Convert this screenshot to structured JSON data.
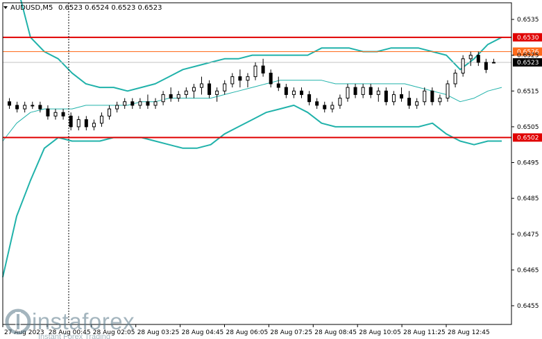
{
  "header": {
    "symbol": "AUDUSD,M5",
    "ohlc": "0.6523 0.6524 0.6523 0.6523"
  },
  "watermark": {
    "logo_icon": "instaforex-logo-icon",
    "name": "instaforex",
    "tagline": "Instant Forex Trading"
  },
  "chart_data": {
    "type": "candlestick",
    "instrument": "AUDUSD",
    "timeframe": "M5",
    "ylim": [
      0.6451,
      0.654
    ],
    "y_ticks": [
      "0.6535",
      "0.6525",
      "0.6515",
      "0.6505",
      "0.6495",
      "0.6485",
      "0.6475",
      "0.6465",
      "0.6455"
    ],
    "y_tick_values": [
      0.6535,
      0.6525,
      0.6515,
      0.6505,
      0.6495,
      0.6485,
      0.6475,
      0.6465,
      0.6455
    ],
    "x_ticks": [
      "27 Aug 2023",
      "28 Aug 00:45",
      "28 Aug 02:05",
      "28 Aug 03:25",
      "28 Aug 04:45",
      "28 Aug 06:05",
      "28 Aug 07:25",
      "28 Aug 08:45",
      "28 Aug 10:05",
      "28 Aug 11:25",
      "28 Aug 12:45"
    ],
    "levels": [
      {
        "name": "resistance",
        "value": 0.653,
        "label": "0.6530",
        "color": "#e00000"
      },
      {
        "name": "target",
        "value": 0.6526,
        "label": "0.6526",
        "color": "#ff6a1a"
      },
      {
        "name": "support",
        "value": 0.6502,
        "label": "0.6502",
        "color": "#e00000"
      }
    ],
    "current_price": {
      "value": 0.6523,
      "label": "0.6523",
      "color": "#000000"
    },
    "bollinger": {
      "color": "#20b2aa",
      "upper": [
        0.6562,
        0.6545,
        0.653,
        0.6526,
        0.6524,
        0.652,
        0.6517,
        0.6516,
        0.6516,
        0.6515,
        0.6516,
        0.6517,
        0.6519,
        0.6521,
        0.6522,
        0.6523,
        0.6524,
        0.6524,
        0.6525,
        0.6525,
        0.6525,
        0.6525,
        0.6525,
        0.6527,
        0.6527,
        0.6527,
        0.6526,
        0.6526,
        0.6527,
        0.6527,
        0.6527,
        0.6526,
        0.6525,
        0.6521,
        0.6524,
        0.6528,
        0.653
      ],
      "middle": [
        0.6501,
        0.6506,
        0.6509,
        0.651,
        0.651,
        0.651,
        0.6511,
        0.6511,
        0.6511,
        0.6511,
        0.6512,
        0.6512,
        0.6513,
        0.6513,
        0.6513,
        0.6513,
        0.6514,
        0.6515,
        0.6516,
        0.6517,
        0.6518,
        0.6518,
        0.6518,
        0.6518,
        0.6517,
        0.6517,
        0.6517,
        0.6517,
        0.6517,
        0.6517,
        0.6516,
        0.6515,
        0.6514,
        0.6512,
        0.6513,
        0.6515,
        0.6516
      ],
      "lower": [
        0.6463,
        0.648,
        0.649,
        0.6499,
        0.6502,
        0.6501,
        0.6501,
        0.6501,
        0.6502,
        0.6502,
        0.6502,
        0.6501,
        0.65,
        0.6499,
        0.6499,
        0.65,
        0.6503,
        0.6505,
        0.6507,
        0.6509,
        0.651,
        0.6511,
        0.6509,
        0.6506,
        0.6505,
        0.6505,
        0.6505,
        0.6505,
        0.6505,
        0.6505,
        0.6505,
        0.6506,
        0.6503,
        0.6501,
        0.65,
        0.6501,
        0.6501
      ]
    },
    "candles": [
      [
        0.6512,
        0.6513,
        0.651,
        0.6511
      ],
      [
        0.6511,
        0.6512,
        0.6509,
        0.651
      ],
      [
        0.651,
        0.6512,
        0.6509,
        0.6511
      ],
      [
        0.6511,
        0.6512,
        0.651,
        0.6511
      ],
      [
        0.6511,
        0.6512,
        0.6509,
        0.651
      ],
      [
        0.651,
        0.6511,
        0.6507,
        0.6508
      ],
      [
        0.6508,
        0.651,
        0.6507,
        0.6509
      ],
      [
        0.6509,
        0.651,
        0.6507,
        0.6508
      ],
      [
        0.6508,
        0.6509,
        0.6504,
        0.6505
      ],
      [
        0.6505,
        0.6508,
        0.6504,
        0.6507
      ],
      [
        0.6507,
        0.6508,
        0.6504,
        0.6505
      ],
      [
        0.6505,
        0.6507,
        0.6504,
        0.6506
      ],
      [
        0.6506,
        0.6509,
        0.6505,
        0.6508
      ],
      [
        0.6508,
        0.6511,
        0.6507,
        0.651
      ],
      [
        0.651,
        0.6512,
        0.6509,
        0.6511
      ],
      [
        0.6511,
        0.6513,
        0.651,
        0.6512
      ],
      [
        0.6512,
        0.6513,
        0.651,
        0.6511
      ],
      [
        0.6511,
        0.6513,
        0.651,
        0.6512
      ],
      [
        0.6512,
        0.6514,
        0.651,
        0.6511
      ],
      [
        0.6511,
        0.6513,
        0.651,
        0.6512
      ],
      [
        0.6512,
        0.6515,
        0.6511,
        0.6514
      ],
      [
        0.6514,
        0.6516,
        0.6512,
        0.6513
      ],
      [
        0.6513,
        0.6515,
        0.6512,
        0.6514
      ],
      [
        0.6514,
        0.6516,
        0.6513,
        0.6515
      ],
      [
        0.6515,
        0.6517,
        0.6513,
        0.6516
      ],
      [
        0.6516,
        0.6519,
        0.6514,
        0.6517
      ],
      [
        0.6517,
        0.6518,
        0.6513,
        0.6514
      ],
      [
        0.6514,
        0.6516,
        0.6512,
        0.6515
      ],
      [
        0.6515,
        0.6518,
        0.6514,
        0.6517
      ],
      [
        0.6517,
        0.652,
        0.6516,
        0.6519
      ],
      [
        0.6519,
        0.6521,
        0.6516,
        0.6518
      ],
      [
        0.6518,
        0.652,
        0.6516,
        0.6519
      ],
      [
        0.6519,
        0.6523,
        0.6518,
        0.6522
      ],
      [
        0.6522,
        0.6524,
        0.6519,
        0.652
      ],
      [
        0.652,
        0.6521,
        0.6516,
        0.6517
      ],
      [
        0.6517,
        0.6519,
        0.6515,
        0.6516
      ],
      [
        0.6516,
        0.6517,
        0.6513,
        0.6514
      ],
      [
        0.6514,
        0.6516,
        0.6513,
        0.6515
      ],
      [
        0.6515,
        0.6516,
        0.6513,
        0.6514
      ],
      [
        0.6514,
        0.6515,
        0.6511,
        0.6512
      ],
      [
        0.6512,
        0.6513,
        0.651,
        0.6511
      ],
      [
        0.6511,
        0.6512,
        0.6509,
        0.651
      ],
      [
        0.651,
        0.6512,
        0.6509,
        0.6511
      ],
      [
        0.6511,
        0.6514,
        0.651,
        0.6513
      ],
      [
        0.6513,
        0.6517,
        0.6512,
        0.6516
      ],
      [
        0.6516,
        0.6517,
        0.6513,
        0.6514
      ],
      [
        0.6514,
        0.6517,
        0.6513,
        0.6516
      ],
      [
        0.6516,
        0.6517,
        0.6513,
        0.6514
      ],
      [
        0.6514,
        0.6516,
        0.6512,
        0.6515
      ],
      [
        0.6515,
        0.6516,
        0.6511,
        0.6512
      ],
      [
        0.6512,
        0.6515,
        0.6511,
        0.6514
      ],
      [
        0.6514,
        0.6516,
        0.6512,
        0.6513
      ],
      [
        0.6513,
        0.6515,
        0.651,
        0.6511
      ],
      [
        0.6511,
        0.6513,
        0.651,
        0.6512
      ],
      [
        0.6512,
        0.6516,
        0.6511,
        0.6515
      ],
      [
        0.6515,
        0.6516,
        0.6511,
        0.6512
      ],
      [
        0.6512,
        0.6514,
        0.6511,
        0.6513
      ],
      [
        0.6513,
        0.6518,
        0.6512,
        0.6517
      ],
      [
        0.6517,
        0.6521,
        0.6516,
        0.652
      ],
      [
        0.652,
        0.6525,
        0.6519,
        0.6524
      ],
      [
        0.6524,
        0.6526,
        0.6522,
        0.6525
      ],
      [
        0.6525,
        0.6526,
        0.6522,
        0.6523
      ],
      [
        0.6523,
        0.6524,
        0.652,
        0.6521
      ],
      [
        0.6523,
        0.6524,
        0.6523,
        0.6523
      ]
    ]
  }
}
